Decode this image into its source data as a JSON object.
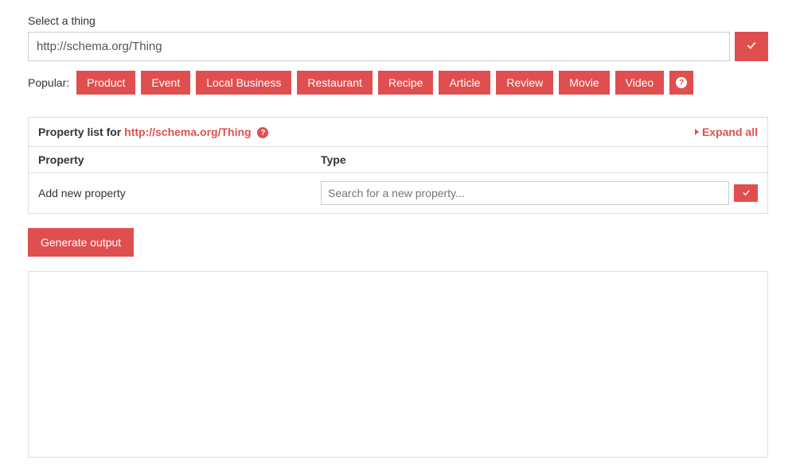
{
  "select": {
    "label": "Select a thing",
    "value": "http://schema.org/Thing"
  },
  "popular": {
    "label": "Popular:",
    "items": [
      "Product",
      "Event",
      "Local Business",
      "Restaurant",
      "Recipe",
      "Article",
      "Review",
      "Movie",
      "Video"
    ],
    "help_icon": "?"
  },
  "panel": {
    "title_prefix": "Property list for ",
    "title_link": "http://schema.org/Thing",
    "help_icon": "?",
    "expand_all": "Expand all",
    "col_property": "Property",
    "col_type": "Type",
    "add_row_label": "Add new property",
    "search_placeholder": "Search for a new property..."
  },
  "generate_label": "Generate output"
}
